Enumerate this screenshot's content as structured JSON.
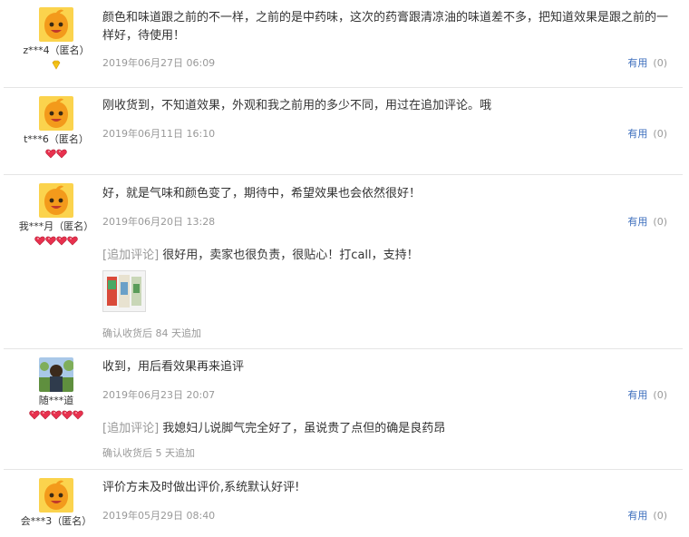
{
  "reviews": [
    {
      "user": "z***4（匿名）",
      "content": "颜色和味道跟之前的不一样，之前的是中药味，这次的药膏跟清凉油的味道差不多，把知道效果是跟之前的一样好，待使用！",
      "date": "2019年06月27日 06:09",
      "useful_label": "有用",
      "useful_count": "(0)",
      "rank": "diamond-1"
    },
    {
      "user": "t***6（匿名）",
      "content": "刚收货到，不知道效果，外观和我之前用的多少不同，用过在追加评论。哦",
      "date": "2019年06月11日 16:10",
      "useful_label": "有用",
      "useful_count": "(0)",
      "rank": "heart-2"
    },
    {
      "user": "我***月（匿名）",
      "content": "好，就是气味和颜色变了，期待中，希望效果也会依然很好！",
      "date": "2019年06月20日 13:28",
      "useful_label": "有用",
      "useful_count": "(0)",
      "append_tag": "[追加评论]",
      "append_text": "很好用，卖家也很负责，很贴心！打call，支持！",
      "confirm": "确认收货后 84 天追加",
      "rank": "heart-4"
    },
    {
      "user": "随***道",
      "content": "收到，用后看效果再来追评",
      "date": "2019年06月23日 20:07",
      "useful_label": "有用",
      "useful_count": "(0)",
      "append_tag": "[追加评论]",
      "append_text": "我媳妇儿说脚气完全好了，虽说贵了点但的确是良药昂",
      "confirm": "确认收货后 5 天追加",
      "rank": "heart-5"
    },
    {
      "user": "会***3（匿名）",
      "content": "评价方未及时做出评价,系统默认好评!",
      "date": "2019年05月29日 08:40",
      "useful_label": "有用",
      "useful_count": "(0)"
    }
  ],
  "colors": {
    "link": "#3c6ebd",
    "muted": "#999999",
    "separator": "#e5e5e5",
    "avatar": "#f7a21b",
    "gem": "#e8314e"
  }
}
